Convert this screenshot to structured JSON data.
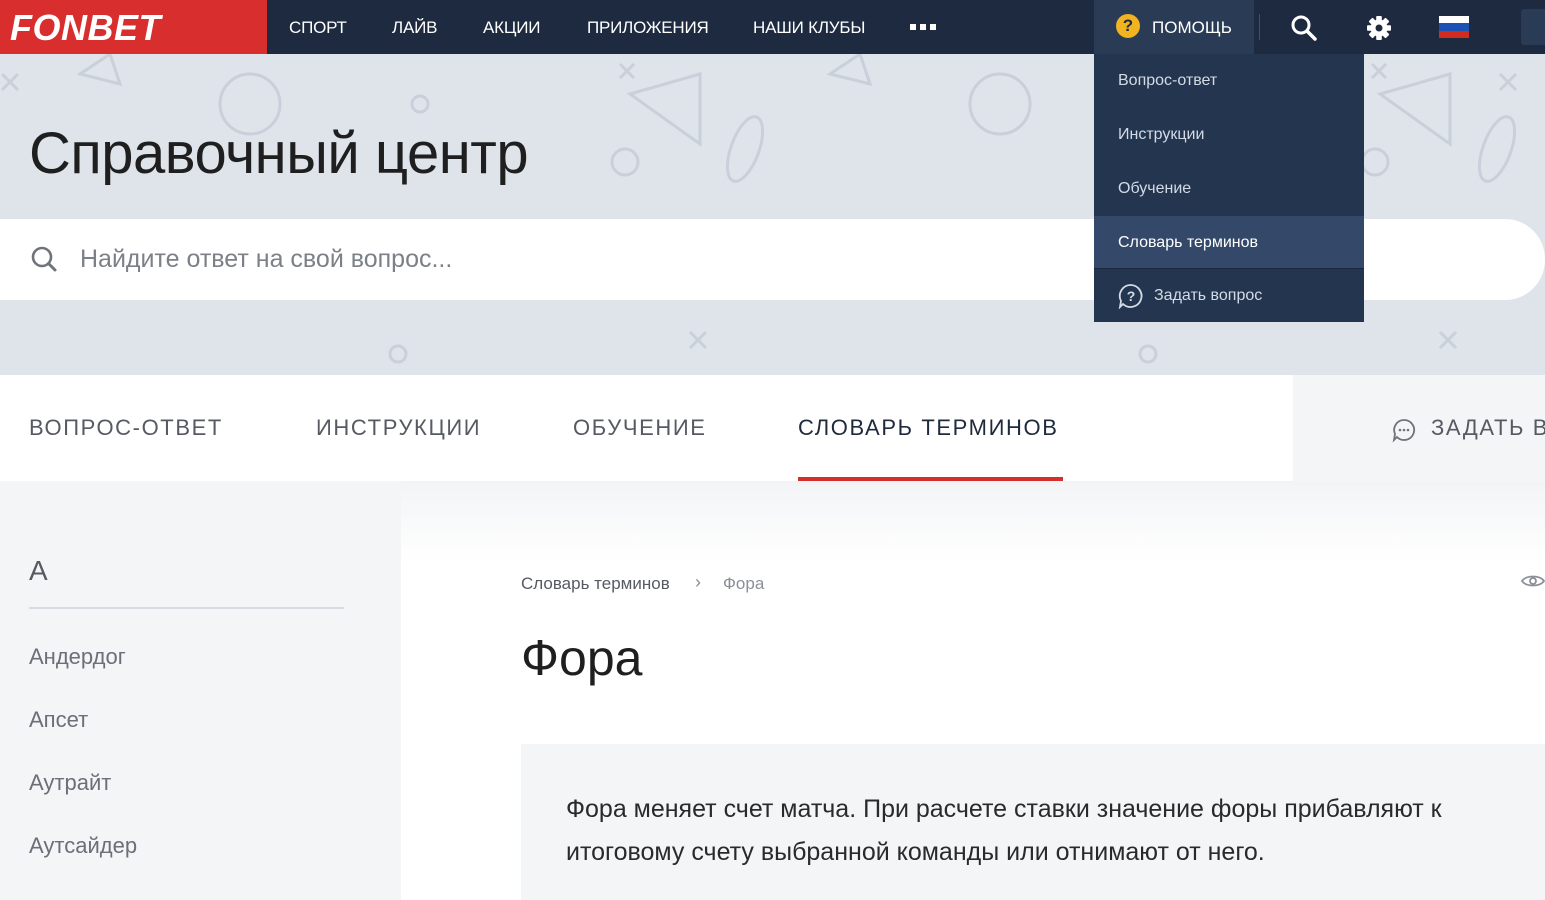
{
  "header": {
    "logo_text": "FONBET",
    "nav": [
      "СПОРТ",
      "ЛАЙВ",
      "АКЦИИ",
      "ПРИЛОЖЕНИЯ",
      "НАШИ КЛУБЫ"
    ],
    "help_label": "ПОМОЩЬ",
    "icons": [
      "more-icon",
      "help-icon",
      "search-icon",
      "gear-icon",
      "russian-flag-icon"
    ]
  },
  "hero": {
    "title": "Справочный центр",
    "search_placeholder": "Найдите ответ на свой вопрос..."
  },
  "help_menu": {
    "items": [
      "Вопрос-ответ",
      "Инструкции",
      "Обучение",
      "Словарь терминов"
    ],
    "active": "Словарь терминов",
    "ask_label": "Задать вопрос"
  },
  "tabs": {
    "items": [
      "ВОПРОС-ОТВЕТ",
      "ИНСТРУКЦИИ",
      "ОБУЧЕНИЕ",
      "СЛОВАРЬ ТЕРМИНОВ"
    ],
    "active": "СЛОВАРЬ ТЕРМИНОВ",
    "ask_label": "ЗАДАТЬ В"
  },
  "sidebar": {
    "letter": "А",
    "terms": [
      "Андердог",
      "Апсет",
      "Аутрайт",
      "Аутсайдер"
    ]
  },
  "article": {
    "breadcrumb": [
      "Словарь терминов",
      "Фора"
    ],
    "breadcrumb_separator": "›",
    "title": "Фора",
    "definition": "Фора меняет счет матча. При расчете ставки значение форы прибавляют к итоговому счету выбранной команды или отнимают от него."
  },
  "colors": {
    "brand_red": "#d92e2e",
    "header_bg": "#1d2a3f",
    "dropdown_bg": "#24354f",
    "accent_underline": "#d32f2f",
    "help_icon": "#f2b320"
  }
}
